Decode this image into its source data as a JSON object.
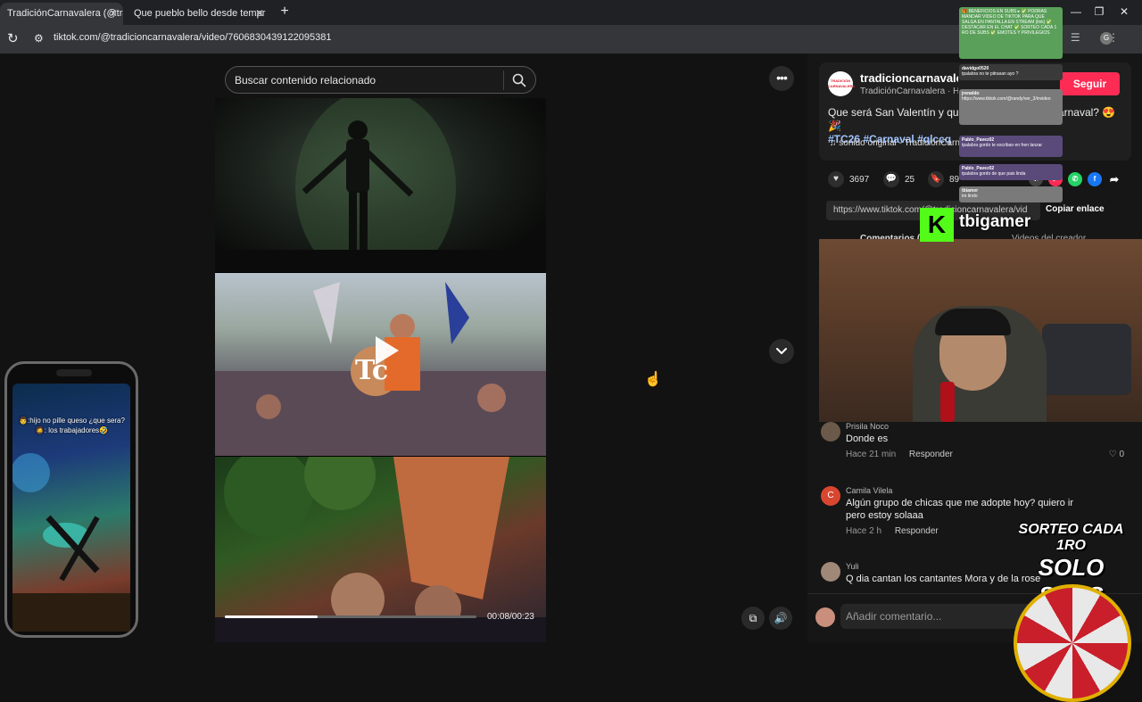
{
  "browser": {
    "tabs": [
      {
        "label": "TradiciónCarnavalera (@tra",
        "close": "✕"
      },
      {
        "label": "Que pueblo bello desde tempr",
        "close": "✕"
      }
    ],
    "new_tab": "+",
    "url": "tiktok.com/@tradicioncarnavalera/video/7606830439122095381",
    "profile_initial": "G"
  },
  "search": {
    "placeholder": "Buscar contenido relacionado"
  },
  "video": {
    "overlay_logo": "Tc",
    "time": "00:08/00:23",
    "progress": 0.37
  },
  "creator": {
    "avatar_text": "TRADICIÓN CARNAVALERA",
    "handle": "tradicioncarnavalera",
    "subtitle": "TradiciónCarnavalera · Hace 5 días",
    "follow_label": "Seguir",
    "description": "Que será San Valentín y que tu no quieras ir al carnaval? 😍🎉",
    "hashtags": [
      "#TC26",
      "#Carnaval",
      "#qlccq"
    ],
    "sound": "♫  sonido original - TradiciónCarnavalera"
  },
  "actions": {
    "likes": "3697",
    "comments": "25",
    "saves": "89"
  },
  "link": {
    "url": "https://www.tiktok.com/@tradicioncarnavalera/vid",
    "copy_label": "Copiar enlace"
  },
  "comment_tabs": {
    "comments": "Comentarios (25)",
    "creator_videos": "Videos del creador"
  },
  "streamer": {
    "kick_letter": "K",
    "name": "tbigamer"
  },
  "comments": [
    {
      "user": "Prisila Noco",
      "text": "Donde es",
      "time": "Hace 21 min",
      "reply": "Responder",
      "likes": "0",
      "avatar_color": "#6b5a4a"
    },
    {
      "user": "Camila Vilela",
      "text": "Algún grupo de chicas que me adopte hoy? quiero ir pero estoy solaaa",
      "time": "Hace 2 h",
      "reply": "Responder",
      "avatar_letter": "C",
      "avatar_color": "#d9462f"
    },
    {
      "user": "Yuli",
      "text": "Q dia cantan los cantantes Mora y de la rose",
      "avatar_color": "#a08878"
    }
  ],
  "comment_input": {
    "placeholder": "Añadir comentario..."
  },
  "phone_overlay": {
    "caption": "👨:hijo no pille queso ¿que sera? 🧔: los trabajadores🤣"
  },
  "chat_overlay": [
    {
      "user": "",
      "text": "🎁 BENEFICIOS EN SUBS ▸ ✅ PODRAS MANDAR VIDEO DE TIKTOK PARA QUE SALGA EN PANTALLA EN STREAM (link) ✅ DESTACAR EN EL CHAT ✅ SORTEO CADA 1 RO DE SUBS ✅ EMOTES Y PRIVILEGIOS",
      "color": "#5aa05a"
    },
    {
      "user": "davidgo0520",
      "text": "tpalabra no te pitrasan ayo ?",
      "color": "#3a3a3a"
    },
    {
      "user": "jrenaldo",
      "text": "https://www.tiktok.com/@randy/ver_3/invideo",
      "color": "#7a7a7a"
    },
    {
      "user": "Pablo_Pavez02",
      "text": "tpalabra gordo te escriban en fren lanzar",
      "color": "#5a4a7a"
    },
    {
      "user": "Pablo_Pavez02",
      "text": "tpalabra gordo de que pais linda",
      "color": "#5a4a7a"
    },
    {
      "user": "tbiamer",
      "text": "ire lindo",
      "color": "#7a7a7a"
    }
  ],
  "raffle": {
    "line1": "SORTEO CADA 1RO",
    "line2": "SOLO SUBS"
  },
  "colors": {
    "accent": "#fe2c55",
    "kick_green": "#53fc18",
    "hashtag": "#9fc3ff"
  }
}
